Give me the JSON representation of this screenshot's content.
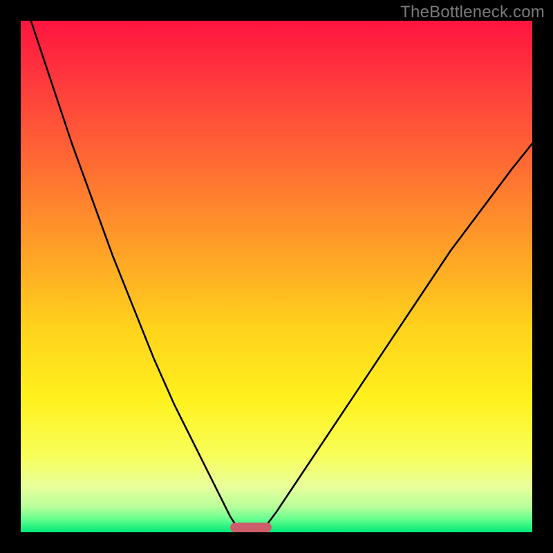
{
  "watermark": "TheBottleneck.com",
  "chart_data": {
    "type": "line",
    "title": "",
    "xlabel": "",
    "ylabel": "",
    "xlim": [
      0,
      100
    ],
    "ylim": [
      0,
      100
    ],
    "grid": false,
    "legend": false,
    "series": [
      {
        "name": "left-branch",
        "x": [
          2,
          6,
          10,
          14,
          18,
          22,
          26,
          30,
          34,
          38,
          41,
          43
        ],
        "y": [
          100,
          88,
          76,
          65,
          54,
          44,
          34,
          25,
          17,
          9,
          3,
          0
        ]
      },
      {
        "name": "right-branch",
        "x": [
          47,
          50,
          54,
          60,
          66,
          72,
          78,
          84,
          90,
          96,
          100
        ],
        "y": [
          0,
          4,
          10,
          19,
          28,
          37,
          46,
          55,
          63,
          71,
          76
        ]
      }
    ],
    "marker": {
      "name": "bottleneck-marker",
      "x_range": [
        41,
        49
      ],
      "y": 0,
      "color": "#cd5d6b"
    },
    "background_gradient_stops": [
      {
        "offset": 0.0,
        "color": "#ff143f"
      },
      {
        "offset": 0.12,
        "color": "#ff3a3d"
      },
      {
        "offset": 0.28,
        "color": "#ff6b33"
      },
      {
        "offset": 0.45,
        "color": "#ffa127"
      },
      {
        "offset": 0.6,
        "color": "#ffd21c"
      },
      {
        "offset": 0.74,
        "color": "#fff11e"
      },
      {
        "offset": 0.85,
        "color": "#f8ff5a"
      },
      {
        "offset": 0.91,
        "color": "#e9ff9a"
      },
      {
        "offset": 0.95,
        "color": "#b8ff9a"
      },
      {
        "offset": 0.975,
        "color": "#63ff8f"
      },
      {
        "offset": 1.0,
        "color": "#00e878"
      }
    ]
  }
}
